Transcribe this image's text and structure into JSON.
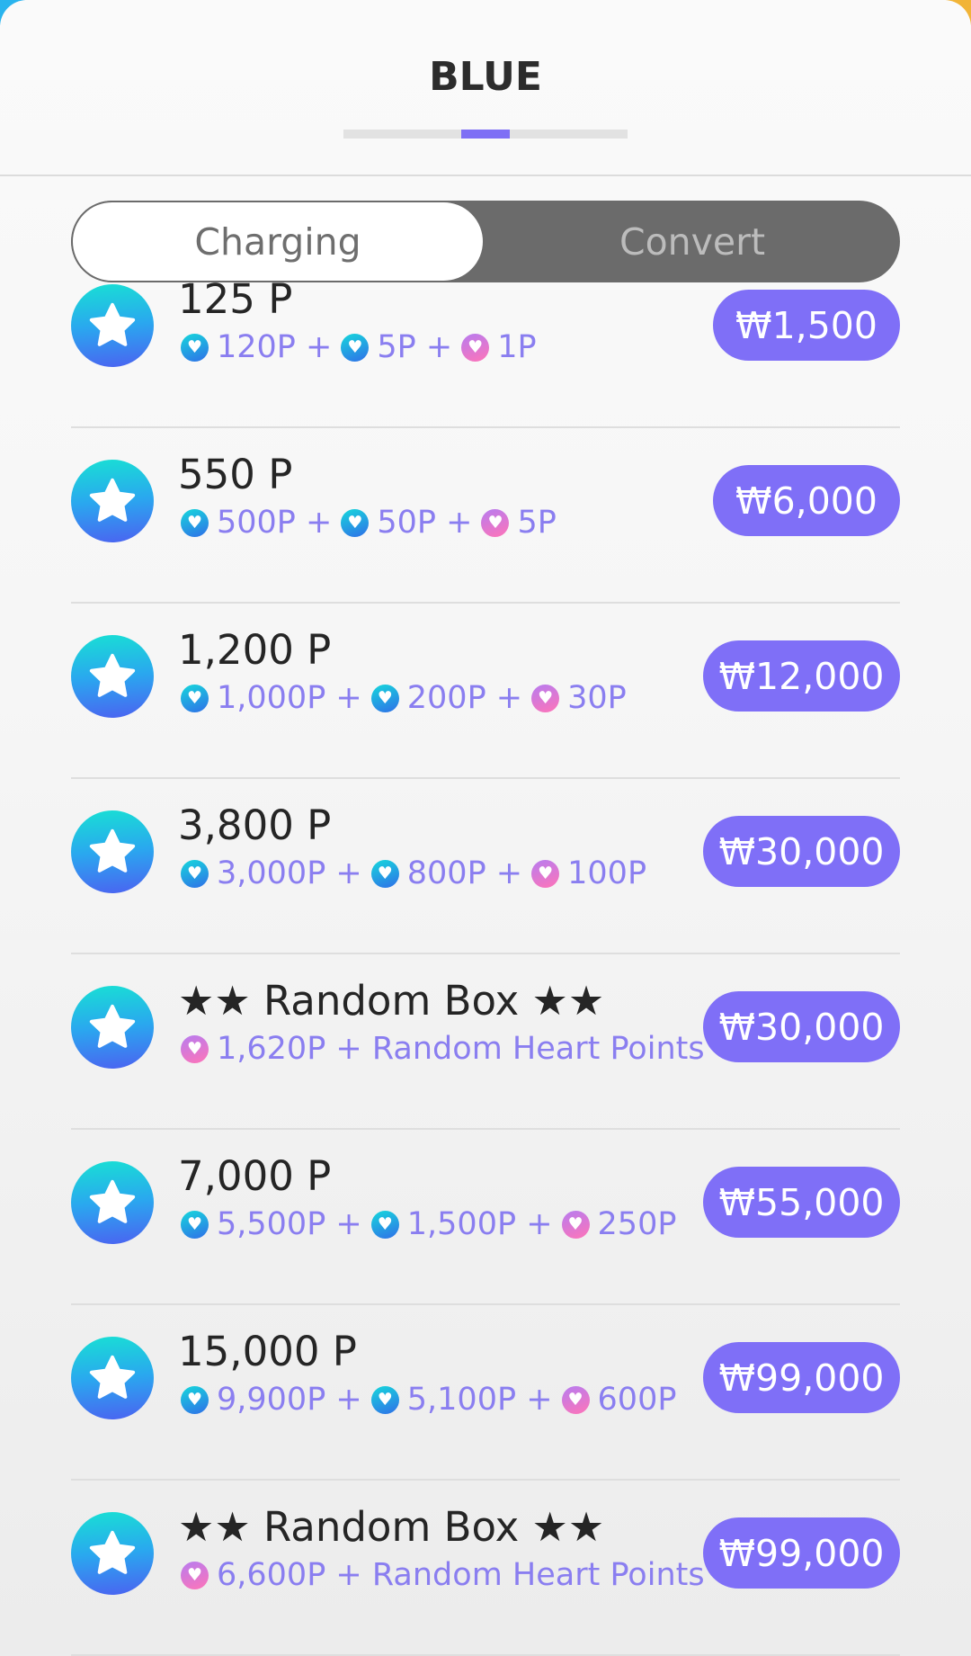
{
  "header": {
    "title": "BLUE"
  },
  "tabs": {
    "charging": "Charging",
    "convert": "Convert"
  },
  "items": [
    {
      "title": "125 P",
      "parts": [
        {
          "type": "blue",
          "text": "120P +"
        },
        {
          "type": "blue",
          "text": "5P +"
        },
        {
          "type": "pink",
          "text": "1P"
        }
      ],
      "price": "₩1,500"
    },
    {
      "title": "550 P",
      "parts": [
        {
          "type": "blue",
          "text": "500P +"
        },
        {
          "type": "blue",
          "text": "50P +"
        },
        {
          "type": "pink",
          "text": "5P"
        }
      ],
      "price": "₩6,000"
    },
    {
      "title": "1,200 P",
      "parts": [
        {
          "type": "blue",
          "text": "1,000P +"
        },
        {
          "type": "blue",
          "text": "200P +"
        },
        {
          "type": "pink",
          "text": "30P"
        }
      ],
      "price": "₩12,000"
    },
    {
      "title": "3,800 P",
      "parts": [
        {
          "type": "blue",
          "text": "3,000P +"
        },
        {
          "type": "blue",
          "text": "800P +"
        },
        {
          "type": "pink",
          "text": "100P"
        }
      ],
      "price": "₩30,000"
    },
    {
      "title": "★★ Random Box ★★",
      "parts": [
        {
          "type": "pink",
          "text": "1,620P + Random Heart Points"
        }
      ],
      "price": "₩30,000"
    },
    {
      "title": "7,000 P",
      "parts": [
        {
          "type": "blue",
          "text": "5,500P +"
        },
        {
          "type": "blue",
          "text": "1,500P +"
        },
        {
          "type": "pink",
          "text": "250P"
        }
      ],
      "price": "₩55,000"
    },
    {
      "title": "15,000 P",
      "parts": [
        {
          "type": "blue",
          "text": "9,900P +"
        },
        {
          "type": "blue",
          "text": "5,100P +"
        },
        {
          "type": "pink",
          "text": "600P"
        }
      ],
      "price": "₩99,000"
    },
    {
      "title": "★★ Random Box ★★",
      "parts": [
        {
          "type": "pink",
          "text": "6,600P + Random Heart Points"
        }
      ],
      "price": "₩99,000"
    }
  ],
  "colors": {
    "accent": "#7f6ff7",
    "detail_text": "#8a7ef0",
    "tab_dark": "#6b6b6b"
  },
  "icons": {
    "item": "star-icon",
    "blue_point": "blue-heart-icon",
    "pink_point": "pink-heart-icon"
  }
}
